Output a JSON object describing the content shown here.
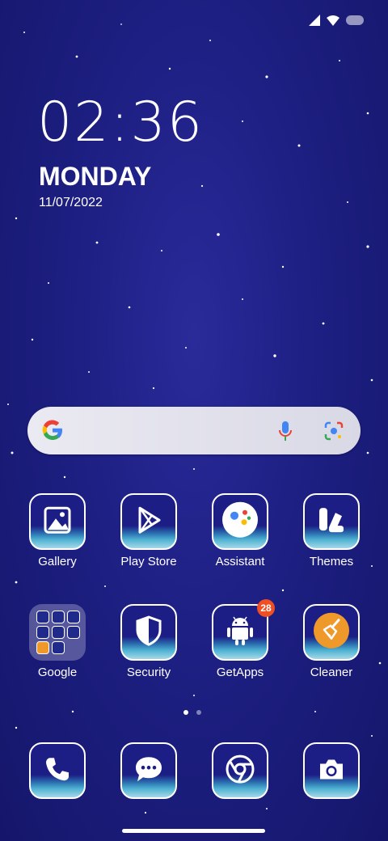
{
  "status_bar": {
    "icons": [
      "signal-icon",
      "wifi-icon",
      "battery-icon"
    ]
  },
  "clock": {
    "time": "02:36",
    "day": "MONDAY",
    "date": "11/07/2022"
  },
  "search_bar": {
    "icons": [
      "google-g-icon",
      "microphone-icon",
      "lens-icon"
    ]
  },
  "apps_row1": [
    {
      "label": "Gallery",
      "icon": "gallery-icon"
    },
    {
      "label": "Play Store",
      "icon": "play-store-icon"
    },
    {
      "label": "Assistant",
      "icon": "assistant-icon"
    },
    {
      "label": "Themes",
      "icon": "themes-icon"
    }
  ],
  "apps_row2": [
    {
      "label": "Google",
      "icon": "folder-icon"
    },
    {
      "label": "Security",
      "icon": "shield-icon"
    },
    {
      "label": "GetApps",
      "icon": "android-icon",
      "badge": "28"
    },
    {
      "label": "Cleaner",
      "icon": "broom-icon"
    }
  ],
  "dock": [
    {
      "icon": "phone-icon"
    },
    {
      "icon": "messages-icon"
    },
    {
      "icon": "chrome-icon"
    },
    {
      "icon": "camera-icon"
    }
  ],
  "page_indicator": {
    "pages": 2,
    "current": 1
  },
  "colors": {
    "wallpaper": "#1d1f82",
    "badge": "#f04e23",
    "accent_orange": "#f0992b"
  }
}
